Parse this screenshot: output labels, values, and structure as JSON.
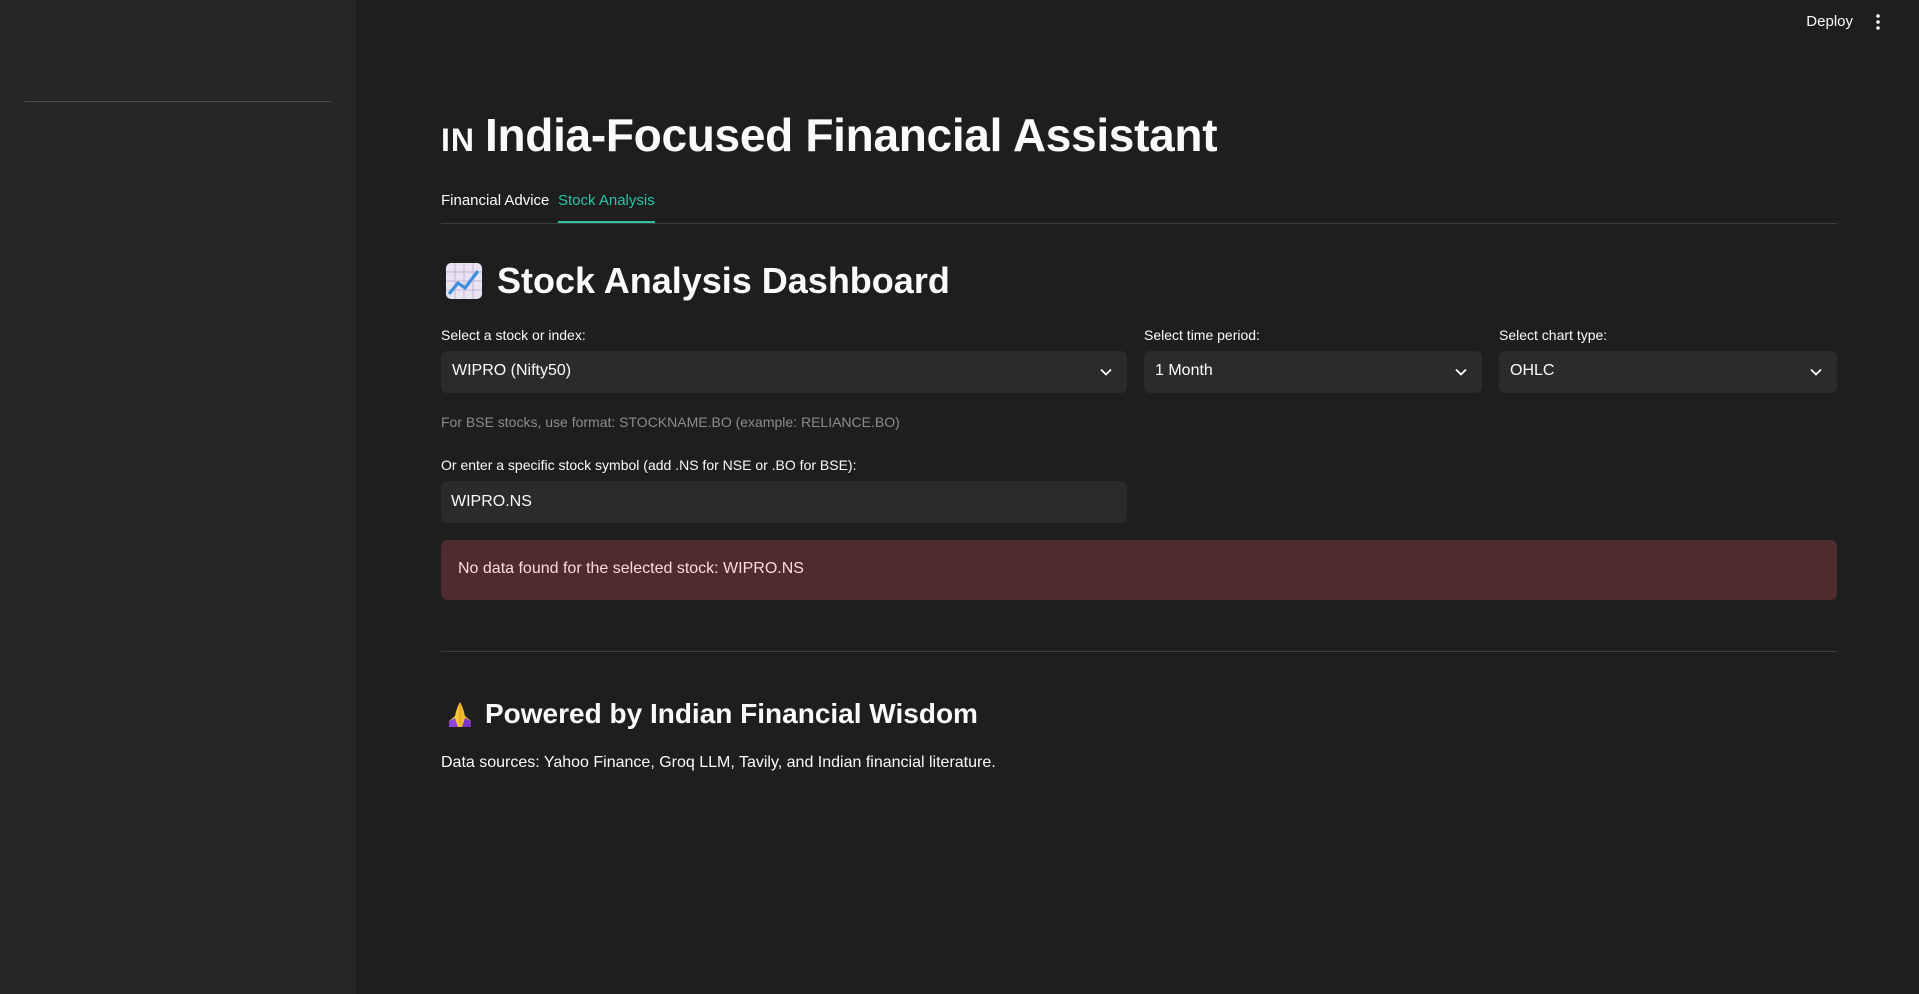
{
  "header": {
    "deploy_label": "Deploy",
    "menu_icon": "more-vertical-icon"
  },
  "page": {
    "flag_text": "IN",
    "title": "India-Focused Financial Assistant"
  },
  "tabs": [
    {
      "label": "Financial Advice",
      "active": false
    },
    {
      "label": "Stock Analysis",
      "active": true
    }
  ],
  "dashboard": {
    "title": "Stock Analysis Dashboard",
    "title_icon": "chart-increasing-icon",
    "stock_select": {
      "label": "Select a stock or index:",
      "value": "WIPRO (Nifty50)"
    },
    "period_select": {
      "label": "Select time period:",
      "value": "1 Month"
    },
    "chart_type_select": {
      "label": "Select chart type:",
      "value": "OHLC"
    },
    "help_text": "For BSE stocks, use format: STOCKNAME.BO (example: RELIANCE.BO)",
    "symbol_input": {
      "label": "Or enter a specific stock symbol (add .NS for NSE or .BO for BSE):",
      "value": "WIPRO.NS"
    },
    "error_message": "No data found for the selected stock: WIPRO.NS"
  },
  "footer": {
    "title": "Powered by Indian Financial Wisdom",
    "title_icon": "folded-hands-icon",
    "text": "Data sources: Yahoo Finance, Groq LLM, Tavily, and Indian financial literature."
  },
  "colors": {
    "accent": "#2bc3a6",
    "background": "#1e1e1e",
    "sidebar": "#262626",
    "error_bg": "#4d2b2f",
    "error_text": "#fdd9dc"
  }
}
